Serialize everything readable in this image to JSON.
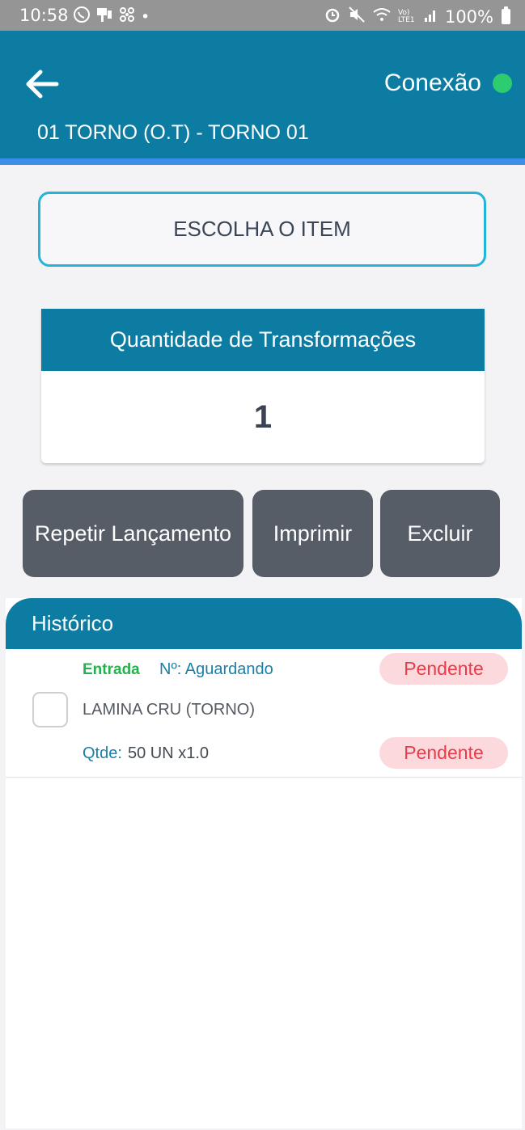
{
  "status_bar": {
    "time": "10:58",
    "battery": "100%",
    "left_icons": [
      "whatsapp-icon",
      "pin-icon",
      "fan-icon",
      "dot-icon"
    ],
    "right_icons": [
      "alarm-icon",
      "mute-icon",
      "wifi-icon",
      "volte-icon",
      "signal-icon",
      "battery-icon"
    ],
    "volte_label": "Vo) LTE1"
  },
  "header": {
    "connection_label": "Conexão",
    "connection_color": "#2ecc71",
    "machine_title": "01 TORNO (O.T) - TORNO 01",
    "background": "#0d7ca3"
  },
  "choose_item": {
    "label": "ESCOLHA O ITEM"
  },
  "quantity": {
    "title": "Quantidade de Transformações",
    "value": "1"
  },
  "actions": {
    "repeat": "Repetir Lançamento",
    "print": "Imprimir",
    "delete": "Excluir"
  },
  "history": {
    "title": "Histórico",
    "rows": [
      {
        "type": "Entrada",
        "number": "Nº: Aguardando",
        "description": "LAMINA CRU (TORNO)",
        "qty_label": "Qtde:",
        "qty_value": "50 UN x1.0",
        "status_top": "Pendente",
        "status_bottom": "Pendente"
      }
    ]
  }
}
